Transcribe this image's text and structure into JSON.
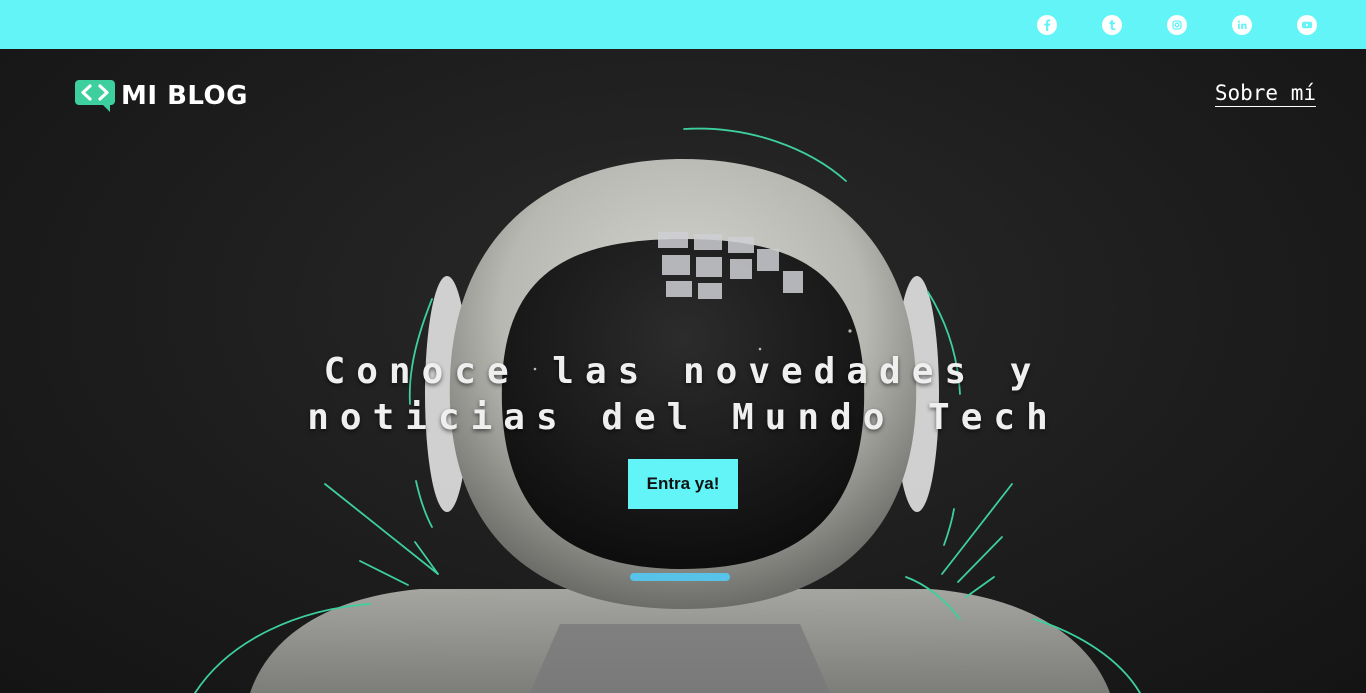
{
  "colors": {
    "accent": "#63f4f7",
    "brand_green": "#3ecf9e",
    "hero_bg": "#1b1b1b",
    "text": "#ffffff"
  },
  "social": [
    {
      "name": "facebook",
      "icon": "facebook-icon"
    },
    {
      "name": "tumblr",
      "icon": "tumblr-icon"
    },
    {
      "name": "instagram",
      "icon": "instagram-icon"
    },
    {
      "name": "linkedin",
      "icon": "linkedin-icon"
    },
    {
      "name": "youtube",
      "icon": "youtube-icon"
    }
  ],
  "header": {
    "logo_icon": "code-bubble-icon",
    "logo_text": "MI BLOG",
    "nav_about": "Sobre mí"
  },
  "hero": {
    "headline_line1": "Conoce las novedades y",
    "headline_line2": "noticias del Mundo Tech",
    "cta_label": "Entra ya!",
    "image": "robot-astronaut-helmet"
  }
}
